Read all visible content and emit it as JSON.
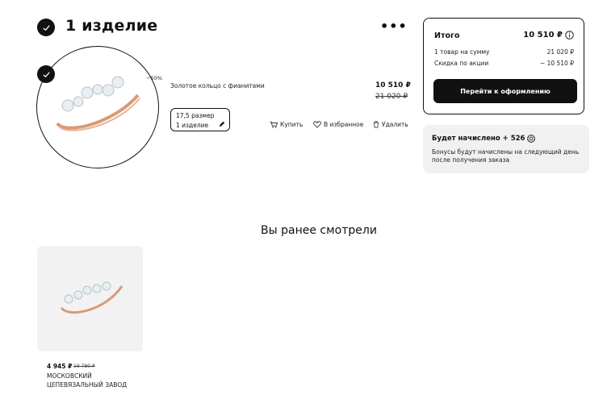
{
  "cart": {
    "title": "1 изделие",
    "more_label": "•••",
    "item": {
      "discount": "−50%",
      "name": "Золотое кольцо с фианитами",
      "price": "10 510 ₽",
      "old_price": "21 020 ₽",
      "size": "17,5 размер",
      "quantity": "1 изделие",
      "buy_label": "Купить",
      "favorite_label": "В избранное",
      "delete_label": "Удалить"
    }
  },
  "summary": {
    "title": "Итого",
    "total": "10 510 ₽",
    "rows": [
      {
        "label": "1 товар на сумму",
        "value": "21 020 ₽"
      },
      {
        "label": "Скидка по акции",
        "value": "− 10 510 ₽"
      }
    ],
    "checkout_label": "Перейти к оформлению"
  },
  "bonus": {
    "title": "Будет начислено + 526",
    "text": "Бонусы будут начислены на следующий день после получения заказа"
  },
  "recent": {
    "title": "Вы ранее смотрели",
    "items": [
      {
        "price": "4 945 ₽",
        "old_price": "19 780 ₽",
        "brand_line1": "МОСКОВСКИЙ",
        "brand_line2": "ЦЕПЕВЯЗАЛЬНЫЙ ЗАВОД"
      }
    ]
  },
  "colors": {
    "accent": "#111111",
    "gold": "#d99a74",
    "panel_bg": "#f1f1f1"
  },
  "icons": [
    "check-icon",
    "more-dots-icon",
    "cart-icon",
    "heart-icon",
    "trash-icon",
    "pencil-icon",
    "info-icon",
    "bonus-coin-icon"
  ]
}
